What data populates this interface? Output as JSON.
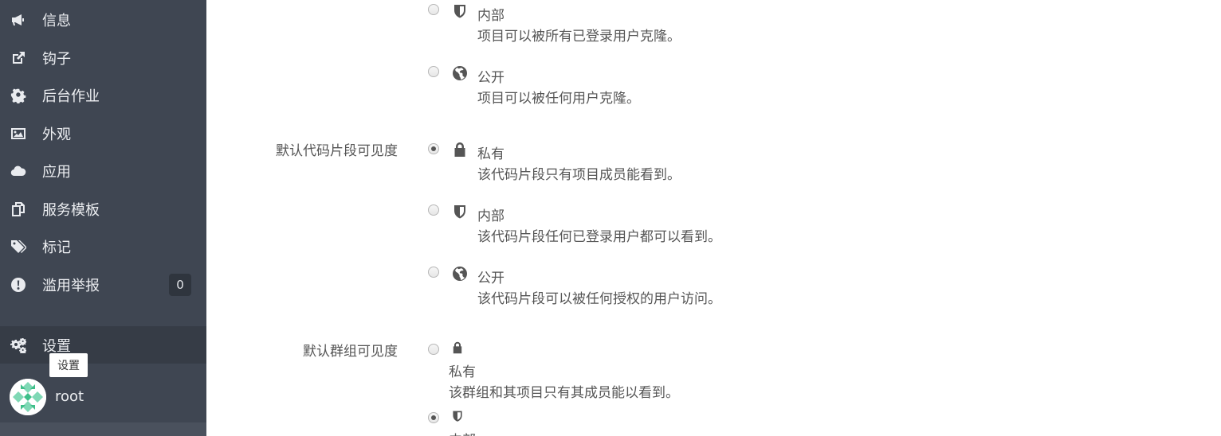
{
  "sidebar": {
    "items": [
      {
        "label": "信息",
        "icon": "bullhorn-icon"
      },
      {
        "label": "钩子",
        "icon": "external-link-icon"
      },
      {
        "label": "后台作业",
        "icon": "gear-icon"
      },
      {
        "label": "外观",
        "icon": "image-icon"
      },
      {
        "label": "应用",
        "icon": "cloud-icon"
      },
      {
        "label": "服务模板",
        "icon": "copy-icon"
      },
      {
        "label": "标记",
        "icon": "tags-icon"
      },
      {
        "label": "滥用举报",
        "icon": "exclamation-circle-icon",
        "badge": "0"
      }
    ],
    "active": {
      "label": "设置",
      "icon": "gears-icon"
    },
    "tooltip": "设置",
    "user": {
      "name": "root"
    }
  },
  "main": {
    "project_visibility_partial": {
      "options": [
        {
          "title": "内部",
          "desc": "项目可以被所有已登录用户克隆。",
          "icon": "shield-icon",
          "checked": false
        },
        {
          "title": "公开",
          "desc": "项目可以被任何用户克隆。",
          "icon": "globe-icon",
          "checked": false
        }
      ]
    },
    "snippet_visibility": {
      "label": "默认代码片段可见度",
      "options": [
        {
          "title": "私有",
          "desc": "该代码片段只有项目成员能看到。",
          "icon": "lock-icon",
          "checked": true
        },
        {
          "title": "内部",
          "desc": "该代码片段任何已登录用户都可以看到。",
          "icon": "shield-icon",
          "checked": false
        },
        {
          "title": "公开",
          "desc": "该代码片段可以被任何授权的用户访问。",
          "icon": "globe-icon",
          "checked": false
        }
      ]
    },
    "group_visibility": {
      "label": "默认群组可见度",
      "options": [
        {
          "title": "私有",
          "desc": "该群组和其项目只有其成员能以看到。",
          "icon": "lock-icon",
          "checked": false
        },
        {
          "title": "内部",
          "desc": "",
          "icon": "shield-icon",
          "checked": true
        }
      ]
    }
  }
}
